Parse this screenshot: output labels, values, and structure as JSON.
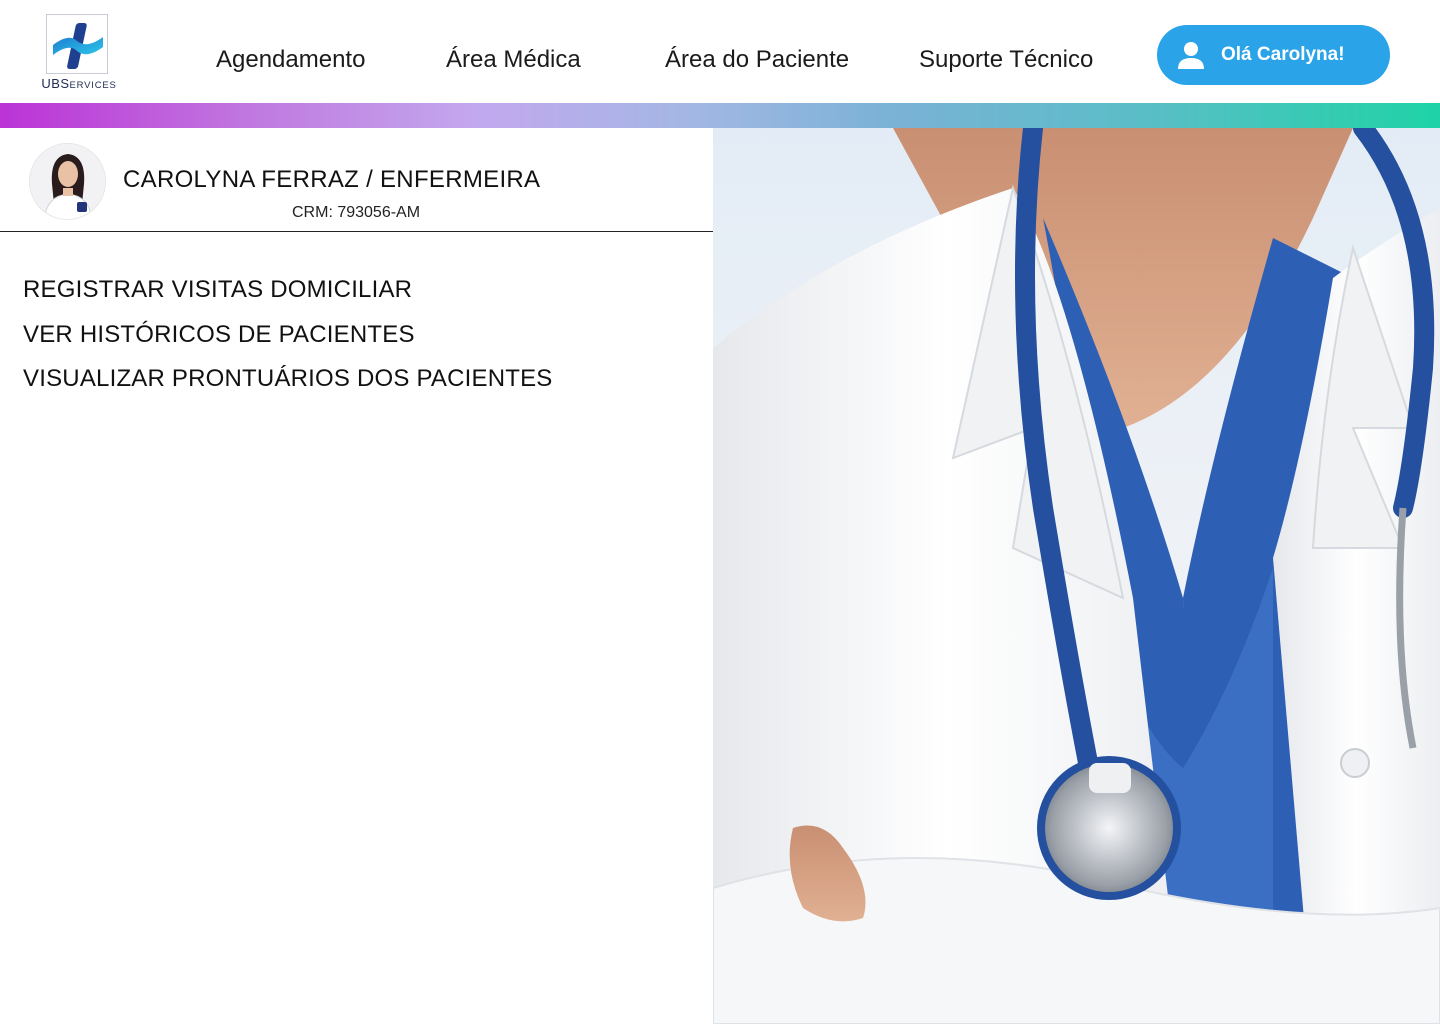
{
  "brand": {
    "logo_main": "UBS",
    "logo_sub": "ERVICES",
    "logo_caps": "S"
  },
  "nav": {
    "items": [
      {
        "label": "Agendamento"
      },
      {
        "label": "Área Médica"
      },
      {
        "label": "Área do Paciente"
      },
      {
        "label": "Suporte Técnico"
      }
    ]
  },
  "user": {
    "greeting": "Olá Carolyna!",
    "icon": "user-icon"
  },
  "profile": {
    "name": "CAROLYNA FERRAZ / ENFERMEIRA",
    "crm": "CRM: 793056-AM"
  },
  "menu": {
    "items": [
      {
        "label": "REGISTRAR VISITAS DOMICILIAR"
      },
      {
        "label": "VER HISTÓRICOS DE PACIENTES"
      },
      {
        "label": "VISUALIZAR PRONTUÁRIOS DOS PACIENTES"
      }
    ]
  },
  "colors": {
    "accent": "#2aa3e8",
    "gradient_start": "#bb33d6",
    "gradient_end": "#1fd3a6",
    "scrubs": "#2d5fb5"
  }
}
